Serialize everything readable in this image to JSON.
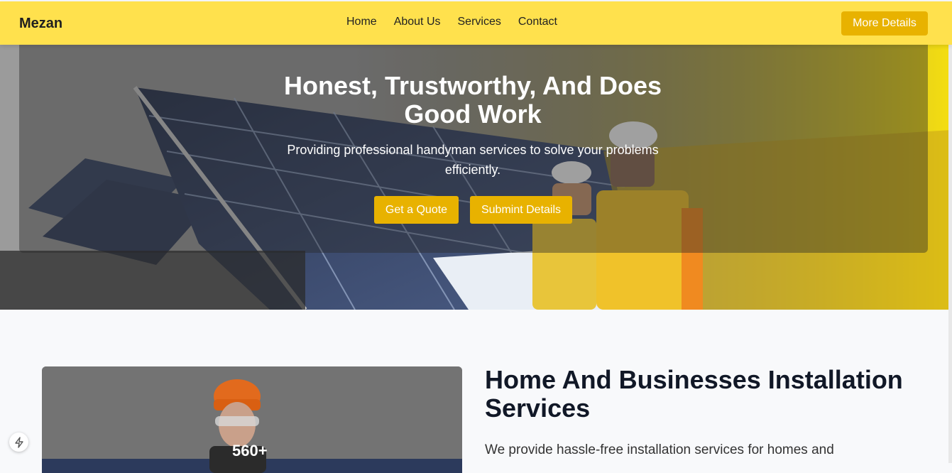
{
  "nav": {
    "brand": "Mezan",
    "links": [
      "Home",
      "About Us",
      "Services",
      "Contact"
    ],
    "cta": "More Details"
  },
  "hero": {
    "title": "Honest, Trustworthy, And Does Good Work",
    "subtitle": "Providing professional handyman services to solve your problems efficiently.",
    "primary_button": "Get a Quote",
    "secondary_button": "Submint Details"
  },
  "services": {
    "stat": "560+",
    "title": "Home And Businesses Installation Services",
    "text": "We provide hassle-free installation services for homes and"
  },
  "colors": {
    "navbar": "#ffe14d",
    "accent": "#e8b200",
    "heading": "#111827"
  },
  "icons": [
    "bolt-icon",
    "solar-panel-illustration",
    "worker-illustration"
  ]
}
